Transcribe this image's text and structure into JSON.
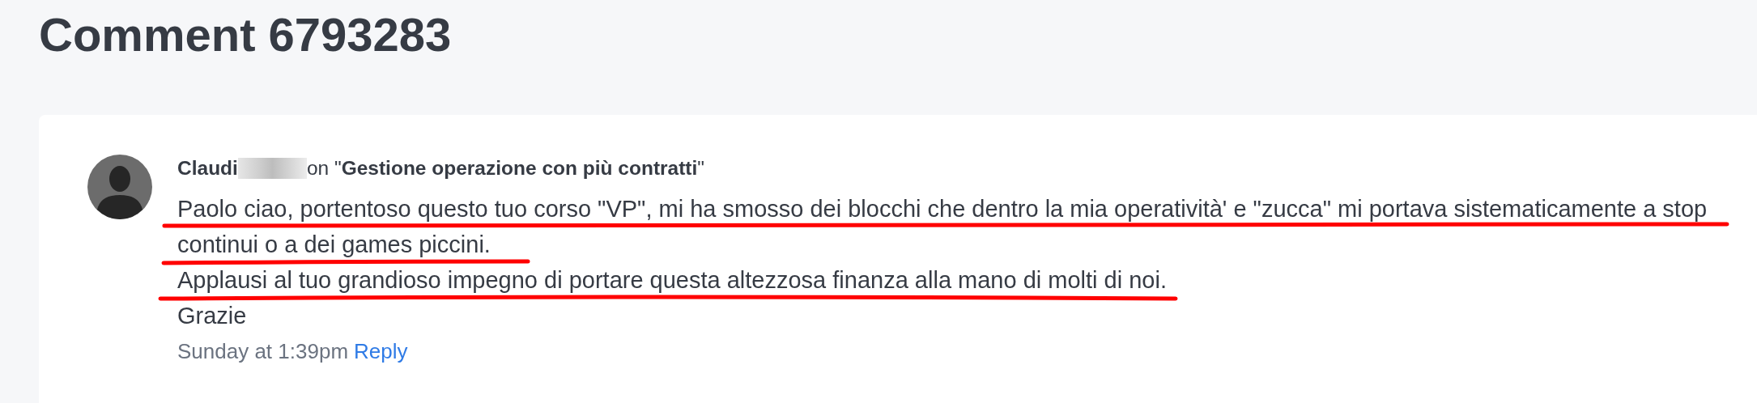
{
  "page_title": "Comment 6793283",
  "comment": {
    "author": "Claudi",
    "on_text": "on \"**Gestione operazione con più contratti**\"",
    "body_lines": [
      "Paolo ciao, portentoso questo tuo corso \"VP\", mi ha smosso dei blocchi che dentro la mia operatività' e \"zucca\" mi portava sistematicamente a stop",
      "continui o a dei games piccini.",
      "Applausi al tuo grandioso impegno di portare questa altezzosa finanza alla mano di molti di noi.",
      "Grazie"
    ],
    "time": "Sunday at 1:39pm",
    "reply": "Reply"
  }
}
